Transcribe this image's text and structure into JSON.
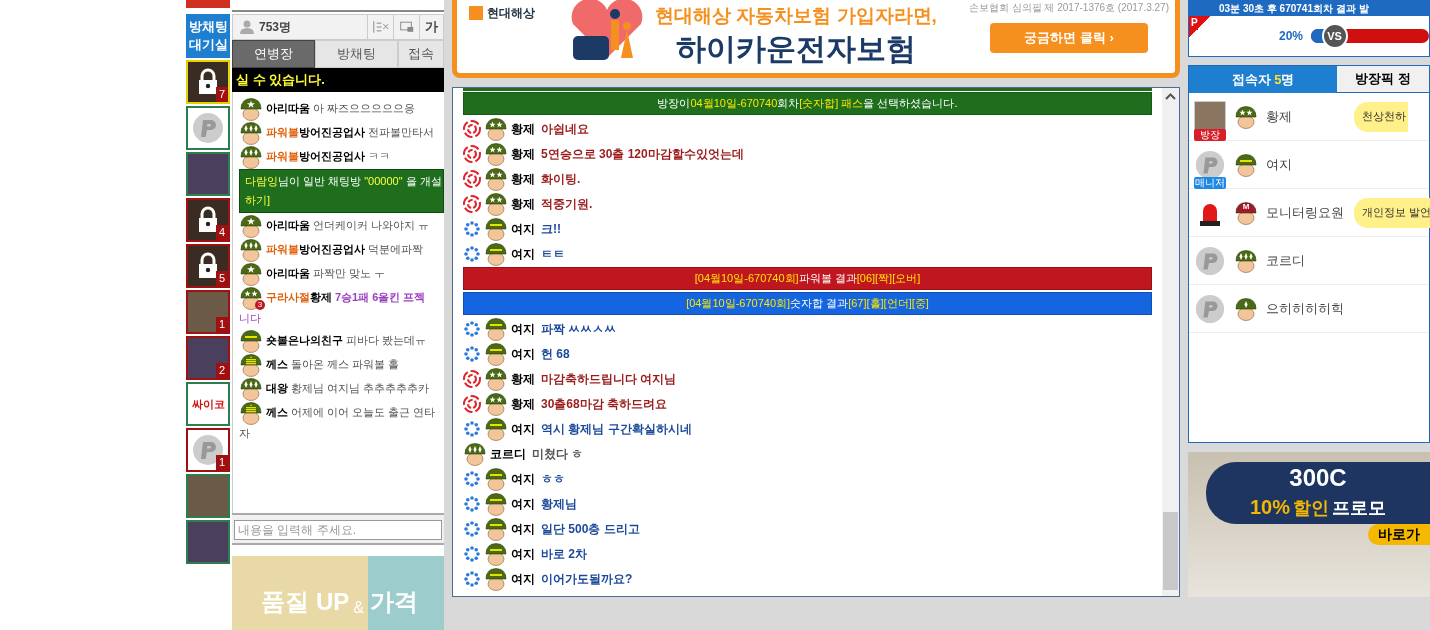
{
  "thumbnails": {
    "lobby_button": [
      "방채팅",
      "대기실"
    ],
    "items": [
      {
        "kind": "lock",
        "color": "#e6d200",
        "count": "7"
      },
      {
        "kind": "p",
        "color": "#2e7d4f"
      },
      {
        "kind": "photo",
        "color": "#2e7d4f"
      },
      {
        "kind": "lock",
        "color": "#a01010",
        "count": "4"
      },
      {
        "kind": "lock",
        "color": "#a01010",
        "count": "5"
      },
      {
        "kind": "photo",
        "color": "#a01010",
        "count": "1"
      },
      {
        "kind": "photo",
        "color": "#a01010",
        "count": "2"
      },
      {
        "kind": "label",
        "color": "#2e7d4f",
        "text": "싸이코"
      },
      {
        "kind": "p",
        "color": "#a01010",
        "count": "1"
      },
      {
        "kind": "photo",
        "color": "#2e7d4f"
      },
      {
        "kind": "photo",
        "color": "#2e7d4f"
      }
    ]
  },
  "left_chat": {
    "user_count": "753명",
    "font_button": "가",
    "tabs": [
      {
        "label": "연병장",
        "selected": true
      },
      {
        "label": "방채팅",
        "selected": false
      },
      {
        "label": "접속",
        "selected": false
      }
    ],
    "notice": "실 수 있습니다.",
    "messages": [
      {
        "kind": "chat",
        "rank": {
          "kind": "star"
        },
        "name": "아리따움",
        "text": "아 짜즈으으으으으응"
      },
      {
        "kind": "chat",
        "rank": {
          "kind": "diamonds"
        },
        "tag": "파워볼",
        "name": "방어진공업사",
        "text": "전파볼만타서"
      },
      {
        "kind": "chat",
        "rank": {
          "kind": "diamonds"
        },
        "tag": "파워볼",
        "name": "방어진공업사",
        "text": "ㅋㅋ"
      },
      {
        "kind": "system",
        "parts": [
          {
            "text": "다람잉",
            "highlight": true
          },
          {
            "text": "님이 일반 채팅방 ",
            "highlight": false
          },
          {
            "text": "\"00000\"",
            "highlight": true
          },
          {
            "text": " 을 개설",
            "highlight": false
          }
        ],
        "line_2": "하기]"
      },
      {
        "kind": "chat",
        "rank": {
          "kind": "star"
        },
        "name": "아리따움",
        "text": "언더케이커 나와야지 ㅠ"
      },
      {
        "kind": "chat",
        "rank": {
          "kind": "diamonds"
        },
        "tag": "파워볼",
        "name": "방어진공업사",
        "text": "덕분에파짝"
      },
      {
        "kind": "chat",
        "rank": {
          "kind": "star"
        },
        "name": "아리따움",
        "text": "파짝만 맞노 ㅜ"
      },
      {
        "kind": "chat",
        "rank": {
          "kind": "stars"
        },
        "badge": "3",
        "tag": "구라사절",
        "name": "황제",
        "text": "7승1패 6올킨 프젝",
        "line_2": "니다",
        "color": "#9b3fbf"
      },
      {
        "kind": "chat",
        "rank": {
          "kind": "bar"
        },
        "name": "숏볼은나의친구",
        "text": "피바다 봤는데ㅠ"
      },
      {
        "kind": "chat",
        "rank": {
          "kind": "chevron"
        },
        "name": "께스",
        "text": "돌아온 께스     파워볼  홀"
      },
      {
        "kind": "chat",
        "rank": {
          "kind": "diamonds"
        },
        "name": "대왕",
        "text": "황제님 여지님 추추추추추카"
      },
      {
        "kind": "chat",
        "rank": {
          "kind": "chevron"
        },
        "name": "께스",
        "text": "어제에 이어 오늘도 출근 연타",
        "line_2": "자"
      }
    ],
    "input_placeholder": "내용을 입력해 주세요.",
    "ad": {
      "text_1": "품질 UP",
      "amp": "&",
      "text_2": "가격"
    }
  },
  "center_ad": {
    "brand": "현대해상",
    "headline": "현대해상 자동차보험 가입자라면,",
    "product": "하이카운전자보험",
    "notice": "손보협회 심의필 제 2017-1376호 (2017.3.27)",
    "button": "궁금하면 클릭 ›"
  },
  "center_chat": {
    "messages": [
      {
        "kind": "notice",
        "color": "#1e6e1e",
        "parts": [
          {
            "text": "방장이 ",
            "highlight": false
          },
          {
            "text": "04월10일-670740",
            "highlight": true
          },
          {
            "text": "회차  ",
            "highlight": false
          },
          {
            "text": "[숫자합] 패스",
            "highlight": true
          },
          {
            "text": " 을 선택하셨습니다.",
            "highlight": false
          }
        ]
      },
      {
        "kind": "chat",
        "device": {
          "kind": "swirl"
        },
        "rank": {
          "kind": "stars"
        },
        "name": "황제",
        "text": "아쉽네요",
        "color": "#9a1c1c"
      },
      {
        "kind": "chat",
        "device": {
          "kind": "swirl"
        },
        "rank": {
          "kind": "stars"
        },
        "name": "황제",
        "text": "5연승으로 30출 120마감할수있엇는데",
        "color": "#9a1c1c"
      },
      {
        "kind": "chat",
        "device": {
          "kind": "swirl"
        },
        "rank": {
          "kind": "stars"
        },
        "name": "황제",
        "text": "화이팅.",
        "color": "#9a1c1c"
      },
      {
        "kind": "chat",
        "device": {
          "kind": "swirl"
        },
        "rank": {
          "kind": "stars"
        },
        "name": "황제",
        "text": "적중기원.",
        "color": "#9a1c1c"
      },
      {
        "kind": "chat",
        "device": {
          "kind": "dots"
        },
        "rank": {
          "kind": "bar"
        },
        "name": "여지",
        "text": "크!!",
        "color": "#1c4a9a"
      },
      {
        "kind": "chat",
        "device": {
          "kind": "dots"
        },
        "rank": {
          "kind": "bar"
        },
        "name": "여지",
        "text": "ㅌㅌ",
        "color": "#1c4a9a"
      },
      {
        "kind": "notice",
        "color": "#c0161f",
        "parts": [
          {
            "text": "[04월10일-670740회]",
            "highlight": true
          },
          {
            "text": " 파워볼 결과 ",
            "highlight": false
          },
          {
            "text": "[06][짝][오버]",
            "highlight": true
          }
        ]
      },
      {
        "kind": "notice",
        "color": "#1565e0",
        "parts": [
          {
            "text": "[04월10일-670740회]",
            "highlight": true
          },
          {
            "text": " 숫자합 결과 ",
            "highlight": false
          },
          {
            "text": "[67][홀][언더][중]",
            "highlight": true
          }
        ]
      },
      {
        "kind": "chat",
        "device": {
          "kind": "dots"
        },
        "rank": {
          "kind": "bar"
        },
        "name": "여지",
        "text": "파짝 ㅆㅆㅅㅆ",
        "color": "#1c4a9a"
      },
      {
        "kind": "chat",
        "device": {
          "kind": "dots"
        },
        "rank": {
          "kind": "bar"
        },
        "name": "여지",
        "text": "헌 68",
        "color": "#1c4a9a"
      },
      {
        "kind": "chat",
        "device": {
          "kind": "swirl"
        },
        "rank": {
          "kind": "stars"
        },
        "name": "황제",
        "text": "마감축하드립니다 여지님",
        "color": "#9a1c1c"
      },
      {
        "kind": "chat",
        "device": {
          "kind": "swirl"
        },
        "rank": {
          "kind": "stars"
        },
        "name": "황제",
        "text": "30출68마감 축하드려요",
        "color": "#9a1c1c"
      },
      {
        "kind": "chat",
        "device": {
          "kind": "dots"
        },
        "rank": {
          "kind": "bar"
        },
        "name": "여지",
        "text": "역시 황제님 구간확실하시네",
        "color": "#1c4a9a"
      },
      {
        "kind": "chat",
        "rank": {
          "kind": "diamonds"
        },
        "name": "코르디",
        "text": "미쳤다 ㅎ",
        "color": "#555555"
      },
      {
        "kind": "chat",
        "device": {
          "kind": "dots"
        },
        "rank": {
          "kind": "bar"
        },
        "name": "여지",
        "text": "ㅎㅎ",
        "color": "#1c4a9a"
      },
      {
        "kind": "chat",
        "device": {
          "kind": "dots"
        },
        "rank": {
          "kind": "bar"
        },
        "name": "여지",
        "text": "황제님",
        "color": "#1c4a9a"
      },
      {
        "kind": "chat",
        "device": {
          "kind": "dots"
        },
        "rank": {
          "kind": "bar"
        },
        "name": "여지",
        "text": "일단 500층 드리고",
        "color": "#1c4a9a"
      },
      {
        "kind": "chat",
        "device": {
          "kind": "dots"
        },
        "rank": {
          "kind": "bar"
        },
        "name": "여지",
        "text": "바로 2차",
        "color": "#1c4a9a"
      },
      {
        "kind": "chat",
        "device": {
          "kind": "dots"
        },
        "rank": {
          "kind": "bar"
        },
        "name": "여지",
        "text": "이어가도될까요?",
        "color": "#1c4a9a"
      }
    ]
  },
  "right": {
    "countdown": "03분 30초 후 670741회차 결과 발",
    "corner": "P",
    "percent": "20%",
    "vs": "VS",
    "level": 0.2,
    "tabs": [
      {
        "label": "접속자",
        "count": "5",
        "unit": "명",
        "selected": true
      },
      {
        "label": "방장픽 정",
        "selected": false
      }
    ],
    "users": [
      {
        "avatar": {
          "kind": "photo"
        },
        "role": "방장",
        "color": "#d61f26",
        "rank": {
          "kind": "stars"
        },
        "name": "황제",
        "bubble": "천상천하"
      },
      {
        "avatar": {
          "kind": "p"
        },
        "role": "매니저",
        "color": "#1e88e5",
        "rank": {
          "kind": "bar"
        },
        "name": "여지"
      },
      {
        "avatar": {
          "kind": "siren"
        },
        "rank": {
          "kind": "letter",
          "text": "M"
        },
        "name": "모니터링요원",
        "bubble": "개인정보 발언"
      },
      {
        "avatar": {
          "kind": "p"
        },
        "rank": {
          "kind": "diamonds"
        },
        "name": "코르디"
      },
      {
        "avatar": {
          "kind": "p"
        },
        "rank": {
          "kind": "diamond"
        },
        "name": "으히히히히힉"
      }
    ],
    "ad": {
      "model": "300C",
      "discount": "10%",
      "sale": "할인",
      "promo": "프로모",
      "cta": "바로가"
    }
  }
}
